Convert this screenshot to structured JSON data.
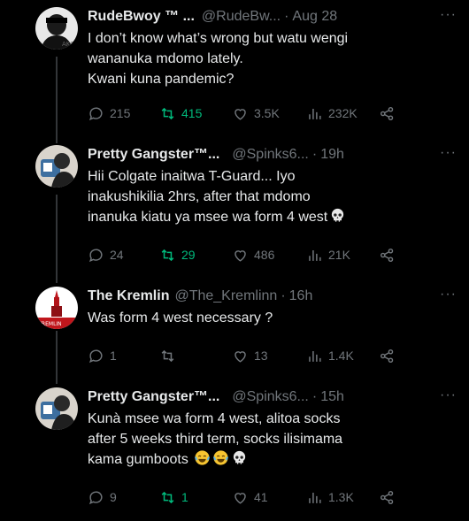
{
  "posts": [
    {
      "name": "RudeBwoy ™ ...",
      "handle": "@RudeBw...",
      "time": "Aug 28",
      "text": "I don’t know what’s wrong but watu wengi\nwananuka mdomo lately.\nKwani kuna pandemic?",
      "replies": "215",
      "reposts": "415",
      "likes": "3.5K",
      "views": "232K"
    },
    {
      "name": "Pretty Gangster™...",
      "handle": "@Spinks6...",
      "time": "19h",
      "text": "Hii Colgate inaitwa T-Guard... Iyo\ninakushikilia 2hrs, after that mdomo\ninanuka kiatu ya msee wa form 4 west",
      "replies": "24",
      "reposts": "29",
      "likes": "486",
      "views": "21K"
    },
    {
      "name": "The Kremlin",
      "handle": "@The_Kremlinn",
      "time": "16h",
      "text": "Was form 4 west necessary ?",
      "replies": "1",
      "reposts": "",
      "likes": "13",
      "views": "1.4K",
      "avatar_text": "KREMLIN"
    },
    {
      "name": "Pretty Gangster™...",
      "handle": "@Spinks6...",
      "time": "15h",
      "text": "Kunà msee wa form 4 west, alitoa socks\nafter 5 weeks third term, socks ilisimama\nkama gumboots",
      "replies": "9",
      "reposts": "1",
      "likes": "41",
      "views": "1.3K"
    }
  ],
  "more_label": "···",
  "separator": "·",
  "colors": {
    "background": "#000000",
    "text": "#e7e9ea",
    "muted": "#71767b",
    "repost_active": "#00ba7c",
    "thread_line": "#333639"
  }
}
